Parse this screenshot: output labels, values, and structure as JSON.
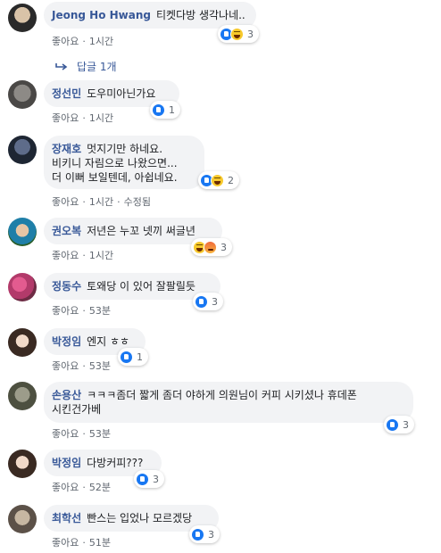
{
  "comments": [
    {
      "author": "Jeong Ho Hwang",
      "text": "티켓다방 생각나네..",
      "like_label": "좋아요",
      "time": "1시간",
      "edited": "",
      "reactions": [
        "like",
        "haha"
      ],
      "count": "3"
    },
    {
      "author": "정선민",
      "text": "도우미아닌가요",
      "like_label": "좋아요",
      "time": "1시간",
      "edited": "",
      "reactions": [
        "like"
      ],
      "count": "1"
    },
    {
      "author": "장재호",
      "text": "멋지기만 하네요.\n비키니 자림으로 나왔으면...\n더 이뻐 보일텐데, 아쉽네요.",
      "like_label": "좋아요",
      "time": "1시간",
      "edited": "수정됨",
      "reactions": [
        "like",
        "haha"
      ],
      "count": "2"
    },
    {
      "author": "권오복",
      "text": "저년은 누꼬 넷끼 써글년",
      "like_label": "좋아요",
      "time": "1시간",
      "edited": "",
      "reactions": [
        "haha",
        "angry"
      ],
      "count": "3"
    },
    {
      "author": "정동수",
      "text": "토왜당 이 있어 잘팔릴듯",
      "like_label": "좋아요",
      "time": "53분",
      "edited": "",
      "reactions": [
        "like"
      ],
      "count": "3"
    },
    {
      "author": "박정임",
      "text": "엔지 ㅎㅎ",
      "like_label": "좋아요",
      "time": "53분",
      "edited": "",
      "reactions": [
        "like"
      ],
      "count": "1"
    },
    {
      "author": "손용산",
      "text": "ㅋㅋㅋ좀더 짧게 좀더 야하게 의원님이 커피 시키셨나 휴데폰\n시킨건가베",
      "like_label": "좋아요",
      "time": "53분",
      "edited": "",
      "reactions": [
        "like"
      ],
      "count": "3"
    },
    {
      "author": "박정임",
      "text": "다방커피???",
      "like_label": "좋아요",
      "time": "52분",
      "edited": "",
      "reactions": [
        "like"
      ],
      "count": "3"
    },
    {
      "author": "최학선",
      "text": "빤스는 입었나 모르겠당",
      "like_label": "좋아요",
      "time": "51분",
      "edited": "",
      "reactions": [
        "like"
      ],
      "count": "3"
    }
  ],
  "replies_label": "답글 1개",
  "colors": {
    "author": "#385898",
    "bubble": "#f2f3f5",
    "like": "#1877f2",
    "meta": "#606770"
  }
}
